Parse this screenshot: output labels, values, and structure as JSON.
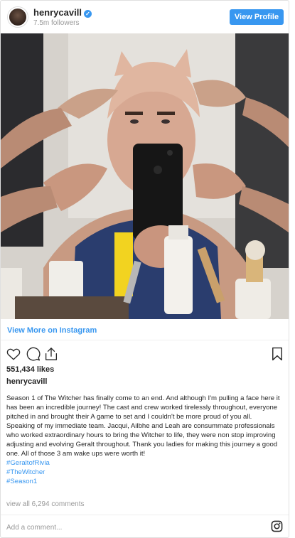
{
  "header": {
    "username": "henrycavill",
    "verified_icon": "verified-badge-icon",
    "followers": "7.5m followers",
    "view_profile_label": "View Profile"
  },
  "post": {
    "image_icon": "post-photo",
    "view_more_label": "View More on Instagram"
  },
  "actions": {
    "like_icon": "heart-icon",
    "comment_icon": "comment-icon",
    "share_icon": "share-icon",
    "save_icon": "bookmark-icon"
  },
  "likes": "551,434 likes",
  "caption": {
    "username": "henrycavill",
    "paragraph_1": "Season 1 of The Witcher has finally come to an end. And although I'm pulling a face here it has been an incredible journey! The cast and crew worked tirelessly throughout, everyone pitched in and brought their A game to set and I couldn't be more proud of you all.",
    "paragraph_2": "Speaking of my immediate team. Jacqui, Ailbhe and Leah are consummate professionals who worked extraordinary hours to bring the Witcher to life, they were non stop improving adjusting and evolving Geralt throughout. Thank you ladies for making this journey a good one. All of those 3 am wake ups were worth it!",
    "hashtags": [
      "#GeraltofRivia",
      "#TheWitcher",
      "#Season1"
    ]
  },
  "comments_link": "view all 6,294 comments",
  "comment_input": {
    "placeholder": "Add a comment...",
    "value": ""
  },
  "footer": {
    "logo_icon": "instagram-logo-icon"
  },
  "colors": {
    "accent": "#3897f0",
    "text": "#262626",
    "muted": "#999999",
    "border": "#efefef"
  }
}
